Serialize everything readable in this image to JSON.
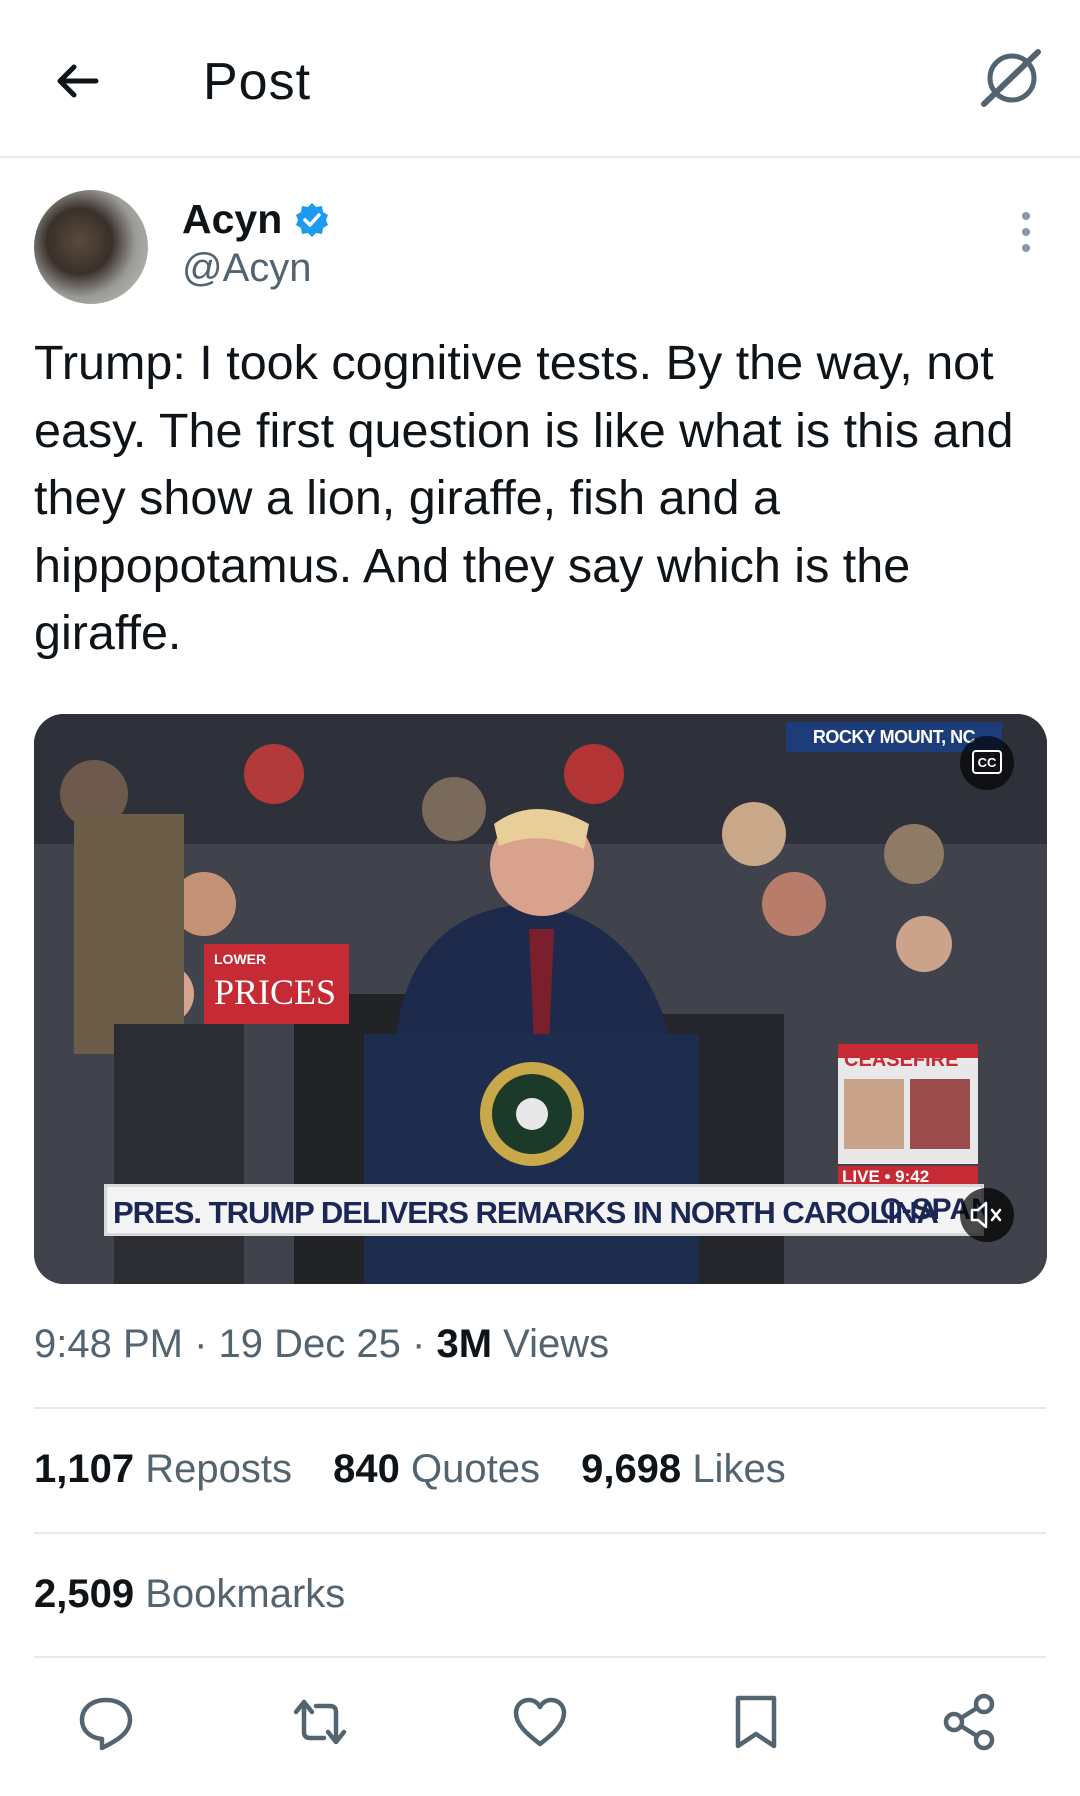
{
  "header": {
    "title": "Post"
  },
  "author": {
    "name": "Acyn",
    "handle": "@Acyn",
    "verified": true,
    "verified_color": "#1d9bf0"
  },
  "tweet": {
    "text": "Trump: I took cognitive tests. By the way, not easy. The first question is like what is this and they show a lion, giraffe, fish and a hippopotamus. And they say which is the giraffe."
  },
  "media": {
    "type": "video",
    "overlay_location": "ROCKY MOUNT, NC",
    "overlay_banner": "PRES. TRUMP DELIVERS REMARKS IN NORTH CAROLINA",
    "overlay_network": "C-SPAN",
    "overlay_sign": "LOWER PRICES",
    "overlay_ceasefire": "CEASEFIRE",
    "overlay_live": "LIVE • 9:42",
    "cc_label": "CC"
  },
  "meta": {
    "time": "9:48 PM",
    "sep1": "·",
    "date": "19 Dec 25",
    "sep2": "·",
    "views_count": "3M",
    "views_label": "Views"
  },
  "stats": {
    "reposts_count": "1,107",
    "reposts_label": "Reposts",
    "quotes_count": "840",
    "quotes_label": "Quotes",
    "likes_count": "9,698",
    "likes_label": "Likes",
    "bookmarks_count": "2,509",
    "bookmarks_label": "Bookmarks"
  },
  "actions": [
    "reply-icon",
    "repost-icon",
    "like-icon",
    "bookmark-icon",
    "share-icon"
  ],
  "colors": {
    "text": "#0f1419",
    "secondary": "#536471",
    "divider": "#e6e9ec"
  }
}
